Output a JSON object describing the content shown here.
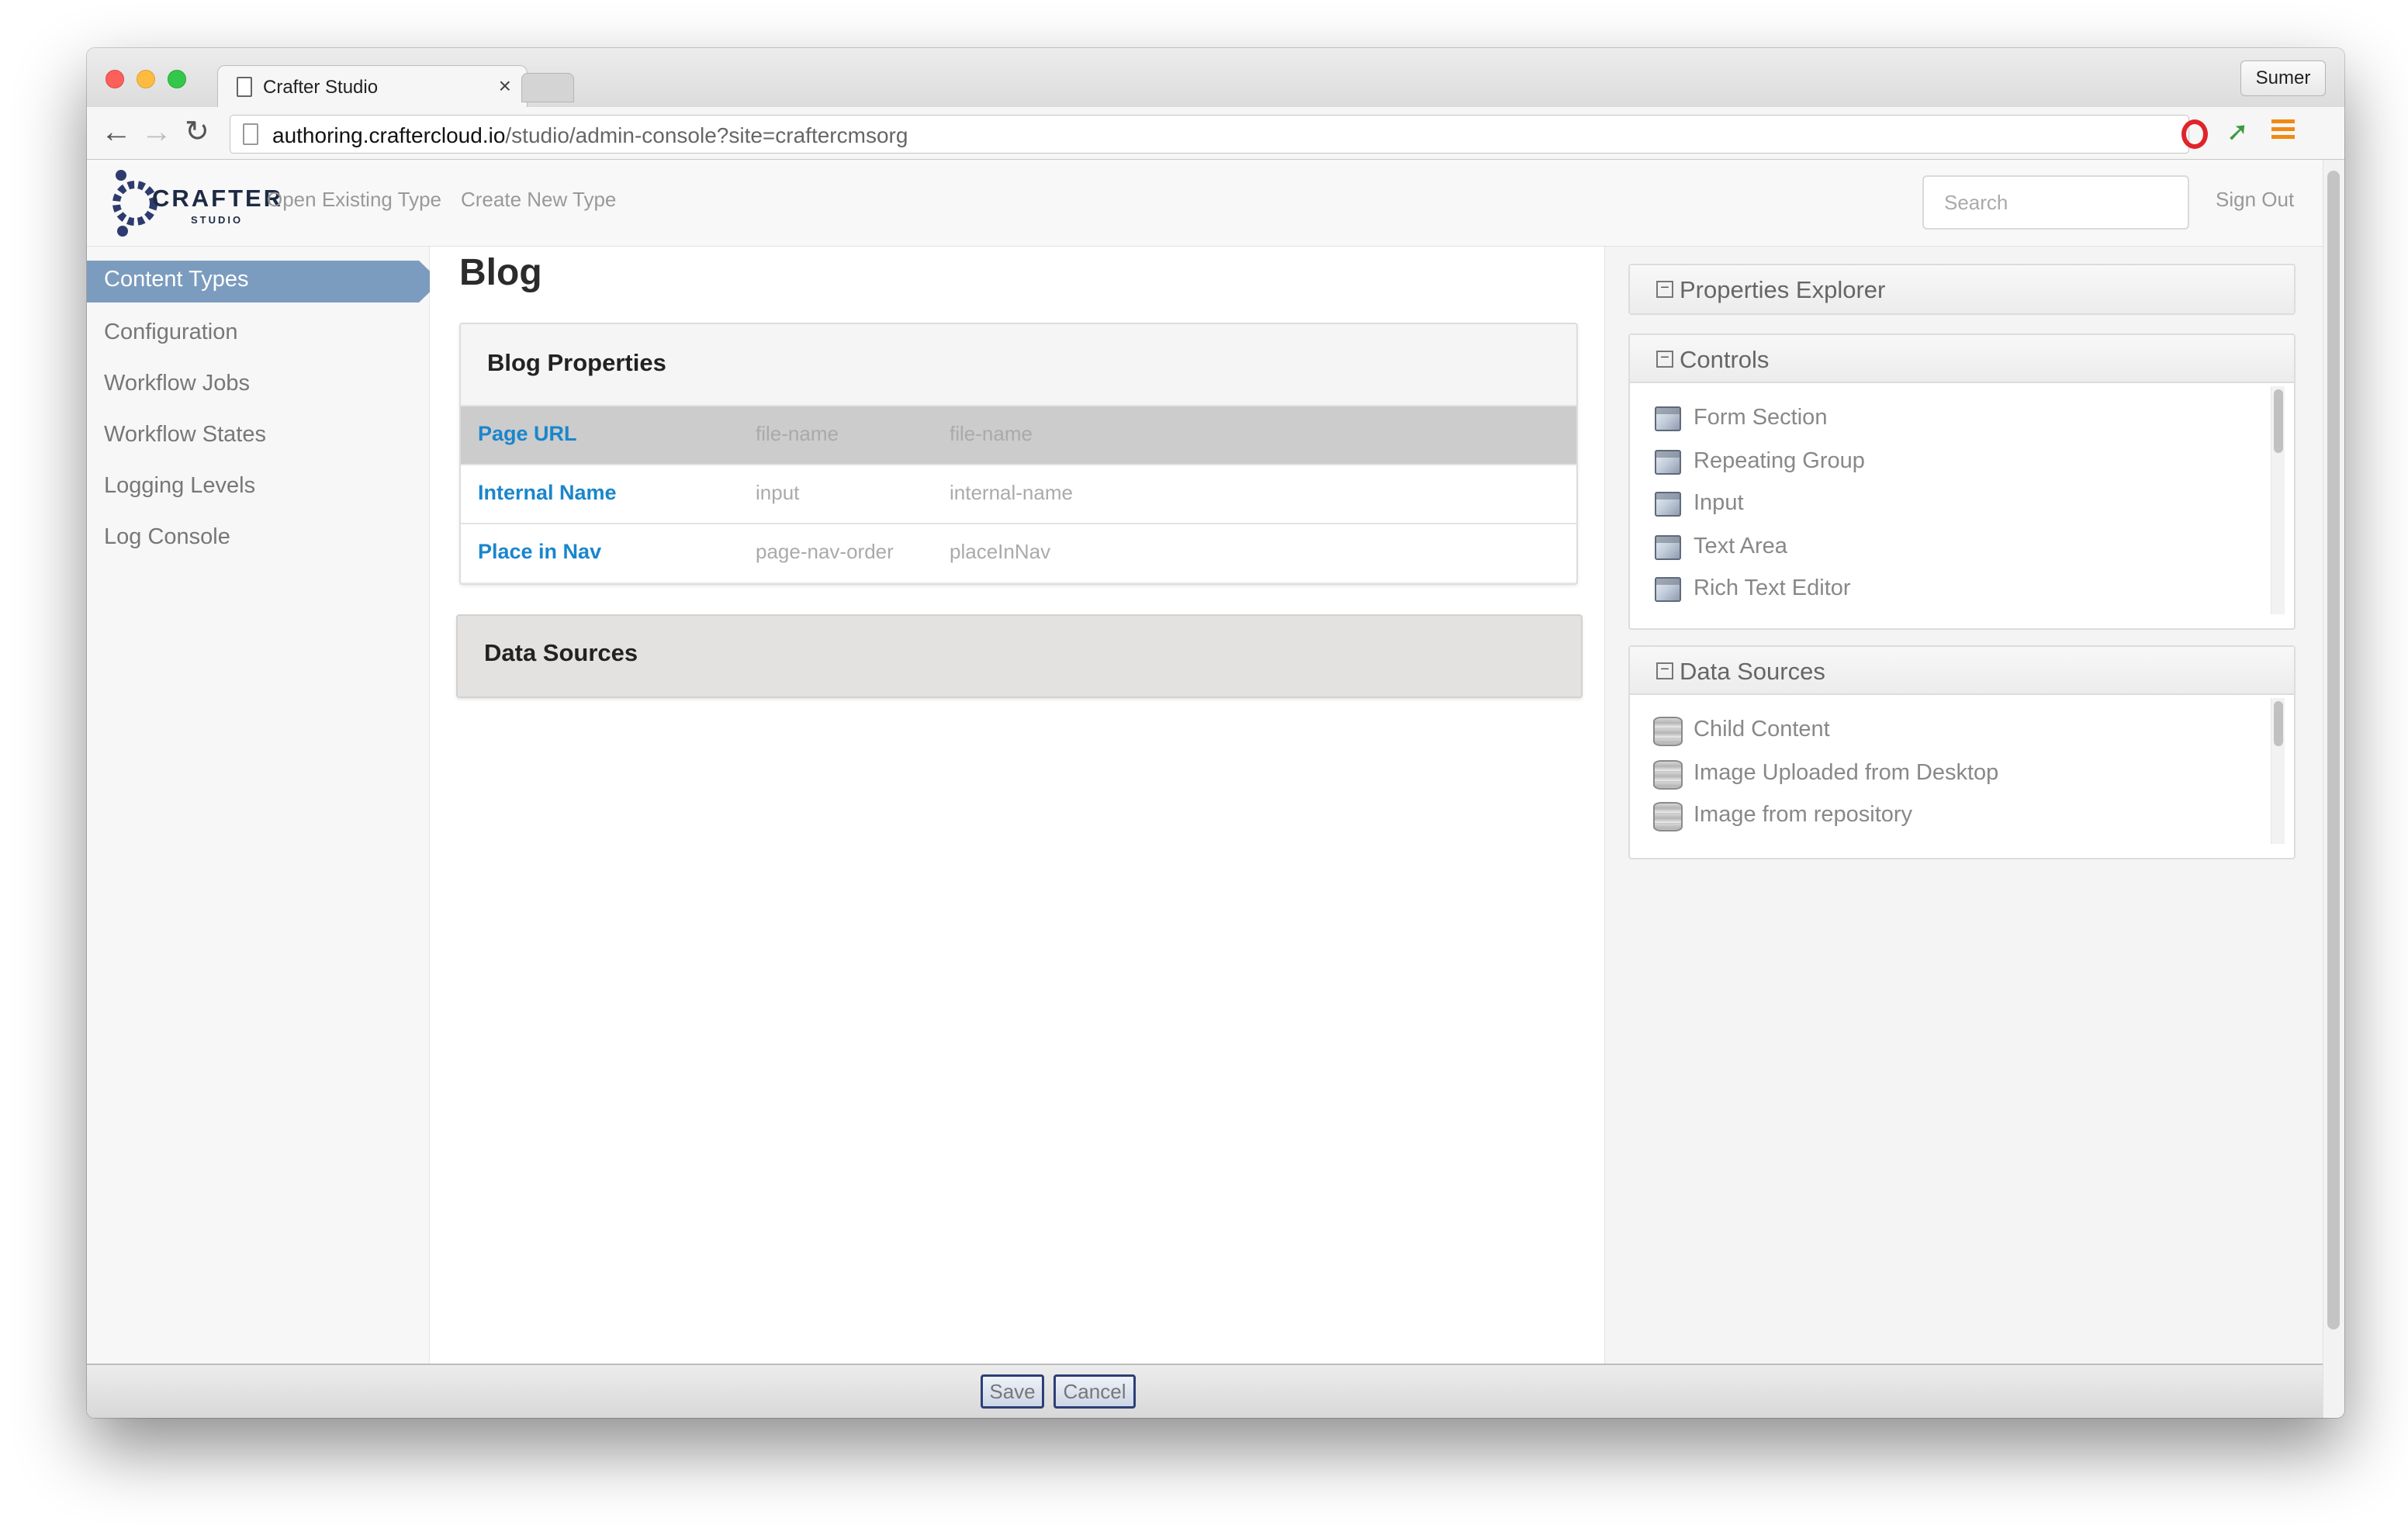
{
  "browser": {
    "tab_title": "Crafter Studio",
    "tab_close": "×",
    "profile": "Sumer",
    "url_host": "authoring.craftercloud.io",
    "url_path": "/studio/admin-console?site=craftercmsorg"
  },
  "header": {
    "logo_text": "CRAFTER",
    "logo_sub": "STUDIO",
    "open_existing": "Open Existing Type",
    "create_new": "Create New Type",
    "search_placeholder": "Search",
    "sign_out": "Sign Out"
  },
  "sidebar": {
    "items": [
      {
        "label": "Content Types",
        "active": true
      },
      {
        "label": "Configuration"
      },
      {
        "label": "Workflow Jobs"
      },
      {
        "label": "Workflow States"
      },
      {
        "label": "Logging Levels"
      },
      {
        "label": "Log Console"
      }
    ]
  },
  "editor": {
    "title": "Blog",
    "properties_title": "Blog Properties",
    "rows": [
      {
        "label": "Page URL",
        "type": "file-name",
        "id": "file-name",
        "selected": true
      },
      {
        "label": "Internal Name",
        "type": "input",
        "id": "internal-name"
      },
      {
        "label": "Place in Nav",
        "type": "page-nav-order",
        "id": "placeInNav"
      }
    ],
    "data_sources_title": "Data Sources"
  },
  "right_panel": {
    "properties_explorer": "Properties Explorer",
    "controls_title": "Controls",
    "controls": [
      "Form Section",
      "Repeating Group",
      "Input",
      "Text Area",
      "Rich Text Editor"
    ],
    "data_sources_title": "Data Sources",
    "data_sources": [
      "Child Content",
      "Image Uploaded from Desktop",
      "Image from repository"
    ],
    "collapse_symbol": "−"
  },
  "footer": {
    "save": "Save",
    "cancel": "Cancel"
  },
  "colors": {
    "active_nav": "#7b9cbe",
    "link_blue": "#1a86cc",
    "button_border": "#2e3f76"
  }
}
